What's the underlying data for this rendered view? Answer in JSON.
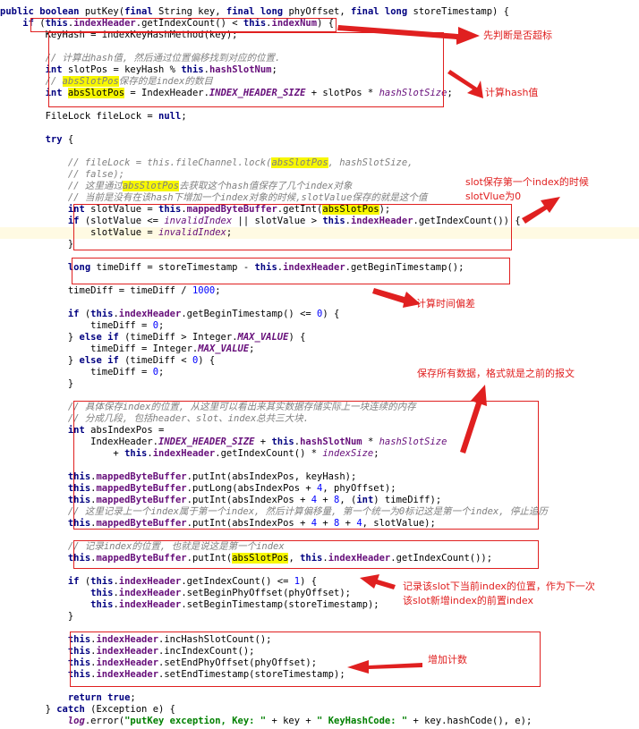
{
  "annotations": {
    "a1": "先判断是否超标",
    "a2": "计算hash值",
    "a3": "slot保存第一个index的时候\nslotVlue为0",
    "a4": "计算时间偏差",
    "a5": "保存所有数据，格式就是之前的报文",
    "a6": "记录该slot下当前index的位置，作为下一次\n该slot新增index的前置index",
    "a7": "增加计数"
  },
  "colors": {
    "annotation": "#e02020",
    "keyword": "#000080",
    "field": "#660e7a",
    "comment": "#808080",
    "highlight": "#f7f700",
    "string": "#008000",
    "number": "#0000ff"
  },
  "code": [
    [
      [
        "kw",
        "public boolean "
      ],
      [
        "plain",
        "putKey("
      ],
      [
        "kw",
        "final "
      ],
      [
        "plain",
        "String key, "
      ],
      [
        "kw",
        "final long "
      ],
      [
        "plain",
        "phyOffset, "
      ],
      [
        "kw",
        "final long "
      ],
      [
        "plain",
        "storeTimestamp) {"
      ]
    ],
    [
      [
        "plain",
        "    "
      ],
      [
        "kw",
        "if "
      ],
      [
        "plain",
        "("
      ],
      [
        "kw",
        "this"
      ],
      [
        "plain",
        "."
      ],
      [
        "field",
        "indexHeader"
      ],
      [
        "plain",
        ".getIndexCount() < "
      ],
      [
        "kw",
        "this"
      ],
      [
        "plain",
        "."
      ],
      [
        "field",
        "indexNum"
      ],
      [
        "plain",
        ") {"
      ]
    ],
    [
      [
        "plain",
        "        KeyHash = indexKeyHashMethod(key);"
      ]
    ],
    [],
    [
      [
        "plain",
        "        "
      ],
      [
        "comment",
        "// 计算出hash值, 然后通过位置偏移找到对应的位置."
      ]
    ],
    [
      [
        "plain",
        "        "
      ],
      [
        "kw",
        "int "
      ],
      [
        "plain",
        "slotPos = keyHash % "
      ],
      [
        "kw",
        "this"
      ],
      [
        "plain",
        "."
      ],
      [
        "field",
        "hashSlotNum"
      ],
      [
        "plain",
        ";"
      ]
    ],
    [
      [
        "plain",
        "        "
      ],
      [
        "comment",
        "// "
      ],
      [
        "hlc",
        "absSlotPos"
      ],
      [
        "comment",
        "保存的是index的数目"
      ]
    ],
    [
      [
        "plain",
        "        "
      ],
      [
        "kw",
        "int "
      ],
      [
        "hl",
        "absSlotPos"
      ],
      [
        "plain",
        " = IndexHeader."
      ],
      [
        "static",
        "INDEX_HEADER_SIZE"
      ],
      [
        "plain",
        " + slotPos * "
      ],
      [
        "italic",
        "hashSlotSize"
      ],
      [
        "plain",
        ";"
      ]
    ],
    [],
    [
      [
        "plain",
        "        FileLock fileLock = "
      ],
      [
        "kw",
        "null"
      ],
      [
        "plain",
        ";"
      ]
    ],
    [],
    [
      [
        "plain",
        "        "
      ],
      [
        "kw",
        "try "
      ],
      [
        "plain",
        "{"
      ]
    ],
    [],
    [
      [
        "plain",
        "            "
      ],
      [
        "comment",
        "// fileLock = this.fileChannel.lock("
      ],
      [
        "hlc",
        "absSlotPos"
      ],
      [
        "comment",
        ", hashSlotSize,"
      ]
    ],
    [
      [
        "plain",
        "            "
      ],
      [
        "comment",
        "// false);"
      ]
    ],
    [
      [
        "plain",
        "            "
      ],
      [
        "comment",
        "// 这里通过"
      ],
      [
        "hlc",
        "absSlotPos"
      ],
      [
        "comment",
        "去获取这个hash值保存了几个index对象"
      ]
    ],
    [
      [
        "plain",
        "            "
      ],
      [
        "comment",
        "// 当前是没有在该hash下增加一个index对象的时候,slotValue保存的就是这个值"
      ]
    ],
    [
      [
        "plain",
        "            "
      ],
      [
        "kw",
        "int "
      ],
      [
        "plain",
        "slotValue = "
      ],
      [
        "kw",
        "this"
      ],
      [
        "plain",
        "."
      ],
      [
        "field",
        "mappedByteBuffer"
      ],
      [
        "plain",
        ".getInt("
      ],
      [
        "hl",
        "absSlotPos"
      ],
      [
        "plain",
        ");"
      ]
    ],
    [
      [
        "plain",
        "            "
      ],
      [
        "kw",
        "if "
      ],
      [
        "plain",
        "(slotValue <= "
      ],
      [
        "italic",
        "invalidIndex"
      ],
      [
        "plain",
        " || slotValue > "
      ],
      [
        "kw",
        "this"
      ],
      [
        "plain",
        "."
      ],
      [
        "field",
        "indexHeader"
      ],
      [
        "plain",
        ".getIndexCount()) {"
      ]
    ],
    [
      [
        "plain",
        "                slotValue = "
      ],
      [
        "italic",
        "invalidIndex"
      ],
      [
        "plain",
        ";"
      ]
    ],
    [
      [
        "plain",
        "            }"
      ]
    ],
    [],
    [
      [
        "plain",
        "            "
      ],
      [
        "kw",
        "long "
      ],
      [
        "plain",
        "timeDiff = storeTimestamp - "
      ],
      [
        "kw",
        "this"
      ],
      [
        "plain",
        "."
      ],
      [
        "field",
        "indexHeader"
      ],
      [
        "plain",
        ".getBeginTimestamp();"
      ]
    ],
    [],
    [
      [
        "plain",
        "            timeDiff = timeDiff / "
      ],
      [
        "num",
        "1000"
      ],
      [
        "plain",
        ";"
      ]
    ],
    [],
    [
      [
        "plain",
        "            "
      ],
      [
        "kw",
        "if "
      ],
      [
        "plain",
        "("
      ],
      [
        "kw",
        "this"
      ],
      [
        "plain",
        "."
      ],
      [
        "field",
        "indexHeader"
      ],
      [
        "plain",
        ".getBeginTimestamp() <= "
      ],
      [
        "num",
        "0"
      ],
      [
        "plain",
        ") {"
      ]
    ],
    [
      [
        "plain",
        "                timeDiff = "
      ],
      [
        "num",
        "0"
      ],
      [
        "plain",
        ";"
      ]
    ],
    [
      [
        "plain",
        "            } "
      ],
      [
        "kw",
        "else if "
      ],
      [
        "plain",
        "(timeDiff > Integer."
      ],
      [
        "static",
        "MAX_VALUE"
      ],
      [
        "plain",
        ") {"
      ]
    ],
    [
      [
        "plain",
        "                timeDiff = Integer."
      ],
      [
        "static",
        "MAX_VALUE"
      ],
      [
        "plain",
        ";"
      ]
    ],
    [
      [
        "plain",
        "            } "
      ],
      [
        "kw",
        "else if "
      ],
      [
        "plain",
        "(timeDiff < "
      ],
      [
        "num",
        "0"
      ],
      [
        "plain",
        ") {"
      ]
    ],
    [
      [
        "plain",
        "                timeDiff = "
      ],
      [
        "num",
        "0"
      ],
      [
        "plain",
        ";"
      ]
    ],
    [
      [
        "plain",
        "            }"
      ]
    ],
    [],
    [
      [
        "plain",
        "            "
      ],
      [
        "comment",
        "// 具体保存index的位置, 从这里可以看出来其实数据存储实际上一块连续的内存"
      ]
    ],
    [
      [
        "plain",
        "            "
      ],
      [
        "comment",
        "// 分成几段, 包括header、slot、index总共三大块."
      ]
    ],
    [
      [
        "plain",
        "            "
      ],
      [
        "kw",
        "int "
      ],
      [
        "plain",
        "absIndexPos ="
      ]
    ],
    [
      [
        "plain",
        "                IndexHeader."
      ],
      [
        "static",
        "INDEX_HEADER_SIZE"
      ],
      [
        "plain",
        " + "
      ],
      [
        "kw",
        "this"
      ],
      [
        "plain",
        "."
      ],
      [
        "field",
        "hashSlotNum"
      ],
      [
        "plain",
        " * "
      ],
      [
        "italic",
        "hashSlotSize"
      ]
    ],
    [
      [
        "plain",
        "                    + "
      ],
      [
        "kw",
        "this"
      ],
      [
        "plain",
        "."
      ],
      [
        "field",
        "indexHeader"
      ],
      [
        "plain",
        ".getIndexCount() * "
      ],
      [
        "italic",
        "indexSize"
      ],
      [
        "plain",
        ";"
      ]
    ],
    [],
    [
      [
        "plain",
        "            "
      ],
      [
        "kw",
        "this"
      ],
      [
        "plain",
        "."
      ],
      [
        "field",
        "mappedByteBuffer"
      ],
      [
        "plain",
        ".putInt(absIndexPos, keyHash);"
      ]
    ],
    [
      [
        "plain",
        "            "
      ],
      [
        "kw",
        "this"
      ],
      [
        "plain",
        "."
      ],
      [
        "field",
        "mappedByteBuffer"
      ],
      [
        "plain",
        ".putLong(absIndexPos + "
      ],
      [
        "num",
        "4"
      ],
      [
        "plain",
        ", phyOffset);"
      ]
    ],
    [
      [
        "plain",
        "            "
      ],
      [
        "kw",
        "this"
      ],
      [
        "plain",
        "."
      ],
      [
        "field",
        "mappedByteBuffer"
      ],
      [
        "plain",
        ".putInt(absIndexPos + "
      ],
      [
        "num",
        "4"
      ],
      [
        "plain",
        " + "
      ],
      [
        "num",
        "8"
      ],
      [
        "plain",
        ", ("
      ],
      [
        "kw",
        "int"
      ],
      [
        "plain",
        ") timeDiff);"
      ]
    ],
    [
      [
        "plain",
        "            "
      ],
      [
        "comment",
        "// 这里记录上一个index属于第一个index, 然后计算偏移量, 第一个统一为0标记这是第一个index, 停止追历"
      ]
    ],
    [
      [
        "plain",
        "            "
      ],
      [
        "kw",
        "this"
      ],
      [
        "plain",
        "."
      ],
      [
        "field",
        "mappedByteBuffer"
      ],
      [
        "plain",
        ".putInt(absIndexPos + "
      ],
      [
        "num",
        "4"
      ],
      [
        "plain",
        " + "
      ],
      [
        "num",
        "8"
      ],
      [
        "plain",
        " + "
      ],
      [
        "num",
        "4"
      ],
      [
        "plain",
        ", slotValue);"
      ]
    ],
    [],
    [
      [
        "plain",
        "            "
      ],
      [
        "comment",
        "// 记录index的位置, 也就是说这是第一个index"
      ]
    ],
    [
      [
        "plain",
        "            "
      ],
      [
        "kw",
        "this"
      ],
      [
        "plain",
        "."
      ],
      [
        "field",
        "mappedByteBuffer"
      ],
      [
        "plain",
        ".putInt("
      ],
      [
        "hl",
        "absSlotPos"
      ],
      [
        "plain",
        ", "
      ],
      [
        "kw",
        "this"
      ],
      [
        "plain",
        "."
      ],
      [
        "field",
        "indexHeader"
      ],
      [
        "plain",
        ".getIndexCount());"
      ]
    ],
    [],
    [
      [
        "plain",
        "            "
      ],
      [
        "kw",
        "if "
      ],
      [
        "plain",
        "("
      ],
      [
        "kw",
        "this"
      ],
      [
        "plain",
        "."
      ],
      [
        "field",
        "indexHeader"
      ],
      [
        "plain",
        ".getIndexCount() <= "
      ],
      [
        "num",
        "1"
      ],
      [
        "plain",
        ") {"
      ]
    ],
    [
      [
        "plain",
        "                "
      ],
      [
        "kw",
        "this"
      ],
      [
        "plain",
        "."
      ],
      [
        "field",
        "indexHeader"
      ],
      [
        "plain",
        ".setBeginPhyOffset(phyOffset);"
      ]
    ],
    [
      [
        "plain",
        "                "
      ],
      [
        "kw",
        "this"
      ],
      [
        "plain",
        "."
      ],
      [
        "field",
        "indexHeader"
      ],
      [
        "plain",
        ".setBeginTimestamp(storeTimestamp);"
      ]
    ],
    [
      [
        "plain",
        "            }"
      ]
    ],
    [],
    [
      [
        "plain",
        "            "
      ],
      [
        "kw",
        "this"
      ],
      [
        "plain",
        "."
      ],
      [
        "field",
        "indexHeader"
      ],
      [
        "plain",
        ".incHashSlotCount();"
      ]
    ],
    [
      [
        "plain",
        "            "
      ],
      [
        "kw",
        "this"
      ],
      [
        "plain",
        "."
      ],
      [
        "field",
        "indexHeader"
      ],
      [
        "plain",
        ".incIndexCount();"
      ]
    ],
    [
      [
        "plain",
        "            "
      ],
      [
        "kw",
        "this"
      ],
      [
        "plain",
        "."
      ],
      [
        "field",
        "indexHeader"
      ],
      [
        "plain",
        ".setEndPhyOffset(phyOffset);"
      ]
    ],
    [
      [
        "plain",
        "            "
      ],
      [
        "kw",
        "this"
      ],
      [
        "plain",
        "."
      ],
      [
        "field",
        "indexHeader"
      ],
      [
        "plain",
        ".setEndTimestamp(storeTimestamp);"
      ]
    ],
    [],
    [
      [
        "plain",
        "            "
      ],
      [
        "kw",
        "return true"
      ],
      [
        "plain",
        ";"
      ]
    ],
    [
      [
        "plain",
        "        } "
      ],
      [
        "kw",
        "catch "
      ],
      [
        "plain",
        "(Exception e) {"
      ]
    ],
    [
      [
        "plain",
        "            "
      ],
      [
        "static",
        "log"
      ],
      [
        "plain",
        ".error("
      ],
      [
        "str",
        "\"putKey exception, Key: \""
      ],
      [
        "plain",
        " + key + "
      ],
      [
        "str",
        "\" KeyHashCode: \""
      ],
      [
        "plain",
        " + key.hashCode(), e);"
      ]
    ]
  ]
}
